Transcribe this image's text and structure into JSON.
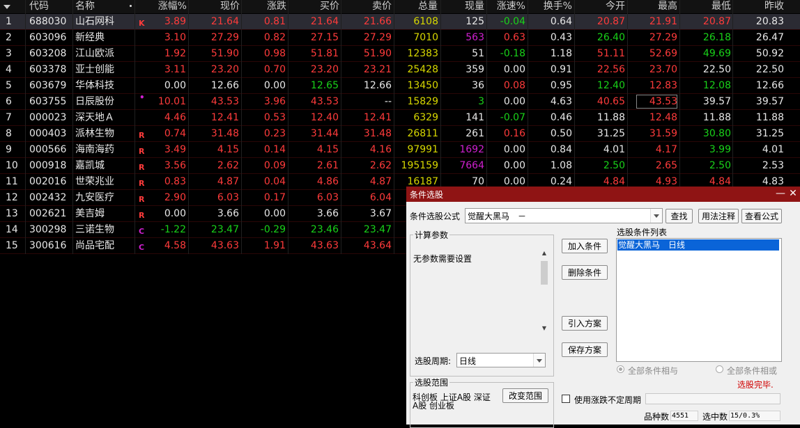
{
  "table": {
    "columns": [
      "",
      "代码",
      "名称",
      "",
      "涨幅%",
      "现价",
      "涨跌",
      "买价",
      "卖价",
      "总量",
      "现量",
      "涨速%",
      "换手%",
      "今开",
      "最高",
      "最低",
      "昨收"
    ],
    "rows": [
      {
        "no": "1",
        "code": "688030",
        "name": "山石网科",
        "mark": "K",
        "chg": "3.89",
        "price": "21.64",
        "diff": "0.81",
        "bid": "21.64",
        "ask": "21.66",
        "vol": "6108",
        "cur": "125",
        "speed": "-0.04",
        "turn": "0.64",
        "open": "20.87",
        "high": "21.91",
        "low": "20.87",
        "prev": "20.83"
      },
      {
        "no": "2",
        "code": "603096",
        "name": "新经典",
        "mark": "",
        "chg": "3.10",
        "price": "27.29",
        "diff": "0.82",
        "bid": "27.15",
        "ask": "27.29",
        "vol": "7010",
        "cur": "563",
        "speed": "0.63",
        "turn": "0.43",
        "open": "26.40",
        "high": "27.29",
        "low": "26.18",
        "prev": "26.47"
      },
      {
        "no": "3",
        "code": "603208",
        "name": "江山欧派",
        "mark": "",
        "chg": "1.92",
        "price": "51.90",
        "diff": "0.98",
        "bid": "51.81",
        "ask": "51.90",
        "vol": "12383",
        "cur": "51",
        "speed": "-0.18",
        "turn": "1.18",
        "open": "51.11",
        "high": "52.69",
        "low": "49.69",
        "prev": "50.92"
      },
      {
        "no": "4",
        "code": "603378",
        "name": "亚士创能",
        "mark": "",
        "chg": "3.11",
        "price": "23.20",
        "diff": "0.70",
        "bid": "23.20",
        "ask": "23.21",
        "vol": "25428",
        "cur": "359",
        "speed": "0.00",
        "turn": "0.91",
        "open": "22.56",
        "high": "23.70",
        "low": "22.50",
        "prev": "22.50"
      },
      {
        "no": "5",
        "code": "603679",
        "name": "华体科技",
        "mark": "",
        "chg": "0.00",
        "price": "12.66",
        "diff": "0.00",
        "bid": "12.65",
        "ask": "12.66",
        "vol": "13450",
        "cur": "36",
        "speed": "0.08",
        "turn": "0.95",
        "open": "12.40",
        "high": "12.83",
        "low": "12.08",
        "prev": "12.66"
      },
      {
        "no": "6",
        "code": "603755",
        "name": "日辰股份",
        "mark": "•",
        "chg": "10.01",
        "price": "43.53",
        "diff": "3.96",
        "bid": "43.53",
        "ask": "--",
        "vol": "15829",
        "cur": "3",
        "speed": "0.00",
        "turn": "4.63",
        "open": "40.65",
        "high": "43.53",
        "low": "39.57",
        "prev": "39.57"
      },
      {
        "no": "7",
        "code": "000023",
        "name": "深天地Ａ",
        "mark": "",
        "chg": "4.46",
        "price": "12.41",
        "diff": "0.53",
        "bid": "12.40",
        "ask": "12.41",
        "vol": "6329",
        "cur": "141",
        "speed": "-0.07",
        "turn": "0.46",
        "open": "11.88",
        "high": "12.48",
        "low": "11.88",
        "prev": "11.88"
      },
      {
        "no": "8",
        "code": "000403",
        "name": "派林生物",
        "mark": "R",
        "chg": "0.74",
        "price": "31.48",
        "diff": "0.23",
        "bid": "31.44",
        "ask": "31.48",
        "vol": "26811",
        "cur": "261",
        "speed": "0.16",
        "turn": "0.50",
        "open": "31.25",
        "high": "31.59",
        "low": "30.80",
        "prev": "31.25"
      },
      {
        "no": "9",
        "code": "000566",
        "name": "海南海药",
        "mark": "R",
        "chg": "3.49",
        "price": "4.15",
        "diff": "0.14",
        "bid": "4.15",
        "ask": "4.16",
        "vol": "97991",
        "cur": "1692",
        "speed": "0.00",
        "turn": "0.84",
        "open": "4.01",
        "high": "4.17",
        "low": "3.99",
        "prev": "4.01"
      },
      {
        "no": "10",
        "code": "000918",
        "name": "嘉凯城",
        "mark": "R",
        "chg": "3.56",
        "price": "2.62",
        "diff": "0.09",
        "bid": "2.61",
        "ask": "2.62",
        "vol": "195159",
        "cur": "7664",
        "speed": "0.00",
        "turn": "1.08",
        "open": "2.50",
        "high": "2.65",
        "low": "2.50",
        "prev": "2.53"
      },
      {
        "no": "11",
        "code": "002016",
        "name": "世荣兆业",
        "mark": "R",
        "chg": "0.83",
        "price": "4.87",
        "diff": "0.04",
        "bid": "4.86",
        "ask": "4.87",
        "vol": "16187",
        "cur": "70",
        "speed": "0.00",
        "turn": "0.24",
        "open": "4.84",
        "high": "4.93",
        "low": "4.84",
        "prev": "4.83"
      },
      {
        "no": "12",
        "code": "002432",
        "name": "九安医疗",
        "mark": "R",
        "chg": "2.90",
        "price": "6.03",
        "diff": "0.17",
        "bid": "6.03",
        "ask": "6.04",
        "vol": "",
        "cur": "",
        "speed": "",
        "turn": "",
        "open": "",
        "high": "",
        "low": "",
        "prev": ""
      },
      {
        "no": "13",
        "code": "002621",
        "name": "美吉姆",
        "mark": "R",
        "chg": "0.00",
        "price": "3.66",
        "diff": "0.00",
        "bid": "3.66",
        "ask": "3.67",
        "vol": "",
        "cur": "",
        "speed": "",
        "turn": "",
        "open": "",
        "high": "",
        "low": "",
        "prev": ""
      },
      {
        "no": "14",
        "code": "300298",
        "name": "三诺生物",
        "mark": "C",
        "chg": "-1.22",
        "price": "23.47",
        "diff": "-0.29",
        "bid": "23.46",
        "ask": "23.47",
        "vol": "",
        "cur": "",
        "speed": "",
        "turn": "",
        "open": "",
        "high": "",
        "low": "",
        "prev": ""
      },
      {
        "no": "15",
        "code": "300616",
        "name": "尚品宅配",
        "mark": "C",
        "chg": "4.58",
        "price": "43.63",
        "diff": "1.91",
        "bid": "43.63",
        "ask": "43.64",
        "vol": "",
        "cur": "",
        "speed": "",
        "turn": "",
        "open": "",
        "high": "",
        "low": "",
        "prev": ""
      }
    ]
  },
  "dialog": {
    "title": "条件选股",
    "minimize": "—",
    "close": "✕",
    "formula_label": "条件选股公式",
    "formula_value": "觉醒大黑马　－",
    "find_button": "查找",
    "usage_button": "用法注释",
    "view_formula_button": "查看公式",
    "params_group": "计算参数",
    "params_text": "无参数需要设置",
    "period_label": "选股周期:",
    "period_value": "日线",
    "add_button": "加入条件",
    "delete_button": "删除条件",
    "import_button": "引入方案",
    "save_button": "保存方案",
    "conditions_label": "选股条件列表",
    "conditions": [
      "觉醒大黑马　日线"
    ],
    "radio_and": "全部条件相与",
    "radio_or": "全部条件相或",
    "done_text": "选股完毕.",
    "scope_group": "选股范围",
    "scope_line1": "科创板 上证A股 深证",
    "scope_line2": "A股 创业板",
    "change_scope_button": "改变范围",
    "use_limit_label": "使用涨跌不定周期",
    "count_label": "品种数",
    "count_value": "4551",
    "selected_label": "选中数",
    "selected_value": "15/0.3%"
  },
  "colors": {
    "red": "#ff3b3b",
    "green": "#19d219",
    "white": "#e8e8e8",
    "yellow": "#d8d800",
    "magenta": "#d020d0",
    "title_bar": "#8f1414"
  }
}
